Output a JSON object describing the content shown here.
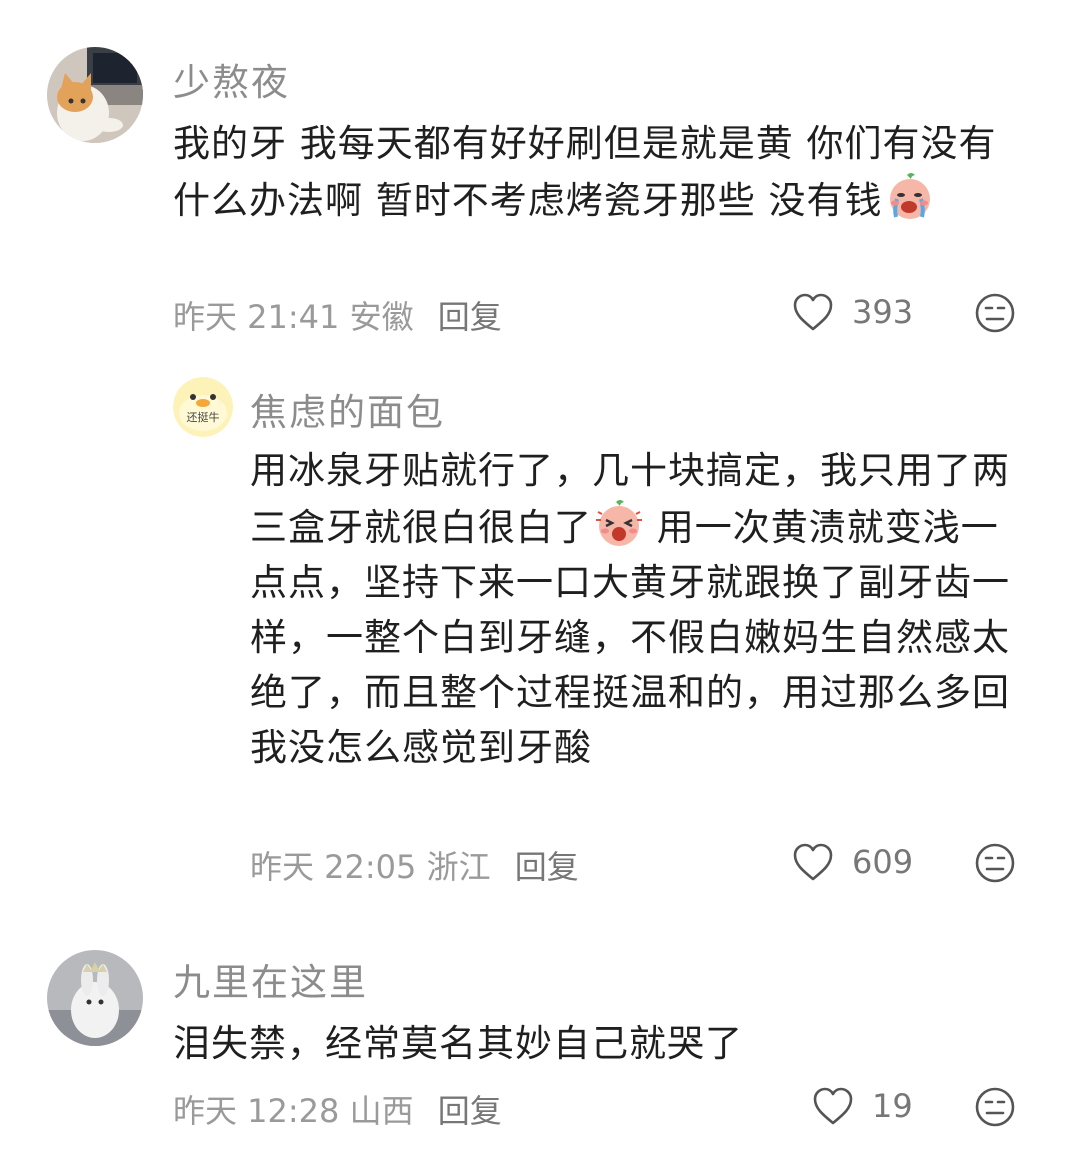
{
  "comments": [
    {
      "username": "少熬夜",
      "text": "我的牙 我每天都有好好刷但是就是黄 你们有没有什么办法啊 暂时不考虑烤瓷牙那些 没有钱",
      "date": "昨天 21:41",
      "location": "安徽",
      "reply_label": "回复",
      "likes": "393",
      "inline_emoji": "crying-face-emoji"
    },
    {
      "username": "焦虑的面包",
      "avatar_text": "还挺牛",
      "text_part1": "用冰泉牙贴就行了，几十块搞定，我只用了两三盒牙就很白很白了",
      "text_part2": " 用一次黄渍就变浅一点点，坚持下来一口大黄牙就跟换了副牙齿一样，一整个白到牙缝，不假白嫩妈生自然感太绝了，而且整个过程挺温和的，用过那么多回我没怎么感觉到牙酸",
      "date": "昨天 22:05",
      "location": "浙江",
      "reply_label": "回复",
      "likes": "609",
      "inline_emoji": "excited-face-emoji"
    },
    {
      "username": "九里在这里",
      "text": "泪失禁，经常莫名其妙自己就哭了",
      "date": "昨天 12:28",
      "location": "山西",
      "reply_label": "回复",
      "likes": "19"
    }
  ],
  "icons": {
    "like": "heart-outline-icon",
    "emoji": "meh-face-icon"
  },
  "colors": {
    "username": "#8c8c8c",
    "meta": "#9a9a9a",
    "text": "#1f1f1f"
  }
}
